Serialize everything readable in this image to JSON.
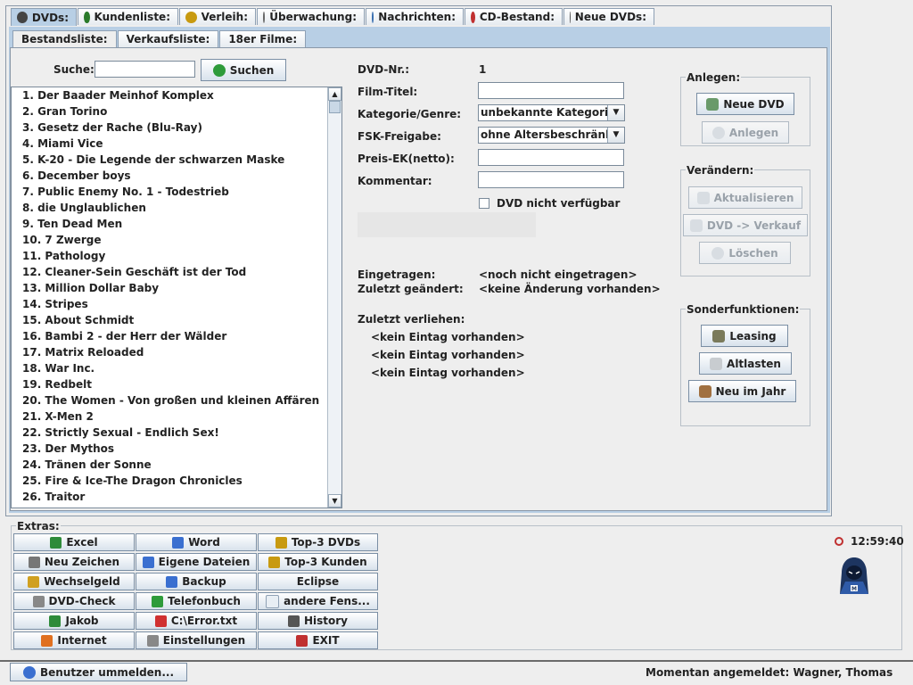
{
  "main_tabs": [
    {
      "label": "DVDs:",
      "icon": "disc-icon",
      "active": true,
      "w": 74,
      "color": "#444"
    },
    {
      "label": "Kundenliste:",
      "icon": "users-icon",
      "active": false,
      "w": 113,
      "color": "#2a7a2a"
    },
    {
      "label": "Verleih:",
      "icon": "books-icon",
      "active": false,
      "w": 86,
      "color": "#c89a10"
    },
    {
      "label": "Überwachung:",
      "icon": "magnifier-icon",
      "active": false,
      "w": 121,
      "color": "#666"
    },
    {
      "label": "Nachrichten:",
      "icon": "mail-icon",
      "active": false,
      "w": 110,
      "color": "#3a6fb0"
    },
    {
      "label": "CD-Bestand:",
      "icon": "cd-icon",
      "active": false,
      "w": 110,
      "color": "#c03030"
    },
    {
      "label": "Neue DVDs:",
      "icon": "film-icon",
      "active": false,
      "w": 102,
      "color": "#555"
    }
  ],
  "sub_tabs": [
    {
      "label": "Bestandsliste:",
      "active": true
    },
    {
      "label": "Verkaufsliste:",
      "active": false
    },
    {
      "label": "18er Filme:",
      "active": false
    }
  ],
  "search": {
    "label": "Suche:",
    "value": "",
    "button": "Suchen"
  },
  "dvd_list": [
    "1. Der Baader Meinhof Komplex",
    "2. Gran Torino",
    "3. Gesetz der Rache (Blu-Ray)",
    "4. Miami Vice",
    "5. K-20 - Die Legende der schwarzen Maske",
    "6. December boys",
    "7. Public Enemy No. 1 - Todestrieb",
    "8. die Unglaublichen",
    "9. Ten Dead Men",
    "10. 7 Zwerge",
    "11. Pathology",
    "12. Cleaner-Sein Geschäft ist der Tod",
    "13. Million Dollar Baby",
    "14. Stripes",
    "15. About Schmidt",
    "16. Bambi 2 - der Herr der Wälder",
    "17. Matrix Reloaded",
    "18. War Inc.",
    "19. Redbelt",
    "20. The Women - Von großen und kleinen Affären",
    "21. X-Men 2",
    "22. Strictly Sexual - Endlich Sex!",
    "23. Der Mythos",
    "24. Tränen der Sonne",
    "25. Fire & Ice-The Dragon Chronicles",
    "26. Traitor"
  ],
  "form": {
    "dvd_nr_label": "DVD-Nr.:",
    "dvd_nr_value": "1",
    "title_label": "Film-Titel:",
    "title_value": "",
    "category_label": "Kategorie/Genre:",
    "category_value": "unbekannte Kategorie",
    "fsk_label": "FSK-Freigabe:",
    "fsk_value": "ohne Altersbeschränk...",
    "price_label": "Preis-EK(netto):",
    "price_value": "",
    "comment_label": "Kommentar:",
    "comment_value": "",
    "unavailable_label": "DVD nicht verfügbar",
    "registered_label": "Eingetragen:",
    "registered_value": "<noch nicht eingetragen>",
    "changed_label": "Zuletzt geändert:",
    "changed_value": "<keine Änderung vorhanden>",
    "lent_label": "Zuletzt verliehen:",
    "lent_entries": [
      "<kein Eintag vorhanden>",
      "<kein Eintag vorhanden>",
      "<kein Eintag vorhanden>"
    ]
  },
  "groups": {
    "create": {
      "title": "Anlegen:",
      "new_dvd": "Neue DVD",
      "create": "Anlegen"
    },
    "modify": {
      "title": "Verändern:",
      "update": "Aktualisieren",
      "to_sale": "DVD -> Verkauf",
      "delete": "Löschen"
    },
    "special": {
      "title": "Sonderfunktionen:",
      "leasing": "Leasing",
      "legacy": "Altlasten",
      "new_year": "Neu im Jahr"
    }
  },
  "extras": {
    "title": "Extras:",
    "buttons": [
      [
        "Excel",
        "Word",
        "Top-3 DVDs"
      ],
      [
        "Neu Zeichen",
        "Eigene Dateien",
        "Top-3 Kunden"
      ],
      [
        "Wechselgeld",
        "Backup",
        "Eclipse"
      ],
      [
        "DVD-Check",
        "Telefonbuch",
        "andere Fens..."
      ],
      [
        "Jakob",
        "C:\\Error.txt",
        "History"
      ],
      [
        "Internet",
        "Einstellungen",
        "EXIT"
      ]
    ],
    "icons": [
      [
        "#2e8b3a",
        "#3a6fd0",
        "#c89a10"
      ],
      [
        "#777",
        "#3a6fd0",
        "#c89a10"
      ],
      [
        "#d0a020",
        "#3a6fd0",
        ""
      ],
      [
        "#888",
        "#2e9b3a",
        "#e8eef4"
      ],
      [
        "#2e8b3a",
        "#d03030",
        "#555"
      ],
      [
        "#e07020",
        "#888",
        "#c03030"
      ]
    ]
  },
  "clock": "12:59:40",
  "logout_button": "Benutzer ummelden...",
  "status": "Momentan angemeldet: Wagner, Thomas"
}
